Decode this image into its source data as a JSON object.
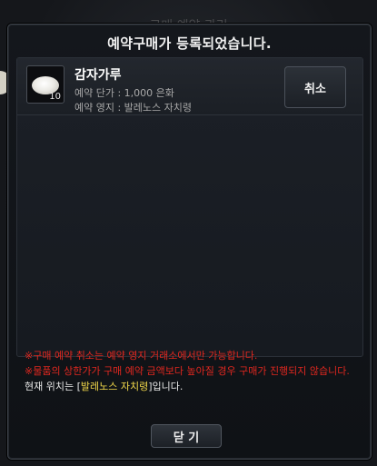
{
  "background": {
    "title": "구매 예약 관리"
  },
  "dialog": {
    "title": "예약구매가 등록되었습니다.",
    "item": {
      "name": "감자가루",
      "quantity": "10",
      "price_line": "예약 단가 : 1,000 은화",
      "territory_line": "예약 영지 : 발레노스 자치령",
      "icon": "potato-flour-icon"
    },
    "cancel_label": "취소",
    "notices": [
      "※구매 예약 취소는 예약 영지 거래소에서만 가능합니다.",
      "※물품의 상한가가 구매 예약 금액보다 높아질 경우 구매가 진행되지 않습니다."
    ],
    "location": {
      "prefix": "현재 위치는 [",
      "place": "발레노스 자치령",
      "suffix": "]입니다."
    },
    "close_label": "닫 기"
  },
  "colors": {
    "notice_red": "#e0271f",
    "highlight_yellow": "#f2d84a"
  }
}
